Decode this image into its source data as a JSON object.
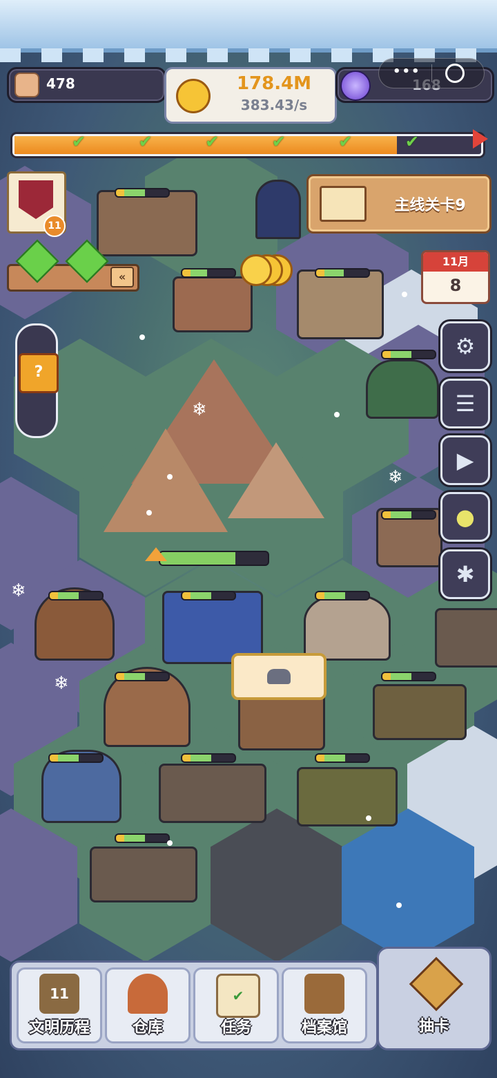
{
  "hud": {
    "population": "478",
    "coins": "178.4M",
    "coin_rate": "383.43/s",
    "crystals": "168"
  },
  "progress": {
    "checkpoints_done": 6,
    "checkpoints_total": 7,
    "fill": 0.82
  },
  "main_quest": {
    "label": "主线关卡9"
  },
  "calendar": {
    "month": "11月",
    "day": "8"
  },
  "badge": {
    "level": "11"
  },
  "pyramid_build_progress": 0.7,
  "bottom_nav": [
    {
      "label": "文明历程",
      "badge": "11"
    },
    {
      "label": "仓库"
    },
    {
      "label": "任务"
    },
    {
      "label": "档案馆"
    },
    {
      "label": "抽卡"
    }
  ],
  "colors": {
    "progress_orange": "#f39a2a",
    "check_green": "#6fd14a",
    "quest_panel": "#d9a46c"
  }
}
